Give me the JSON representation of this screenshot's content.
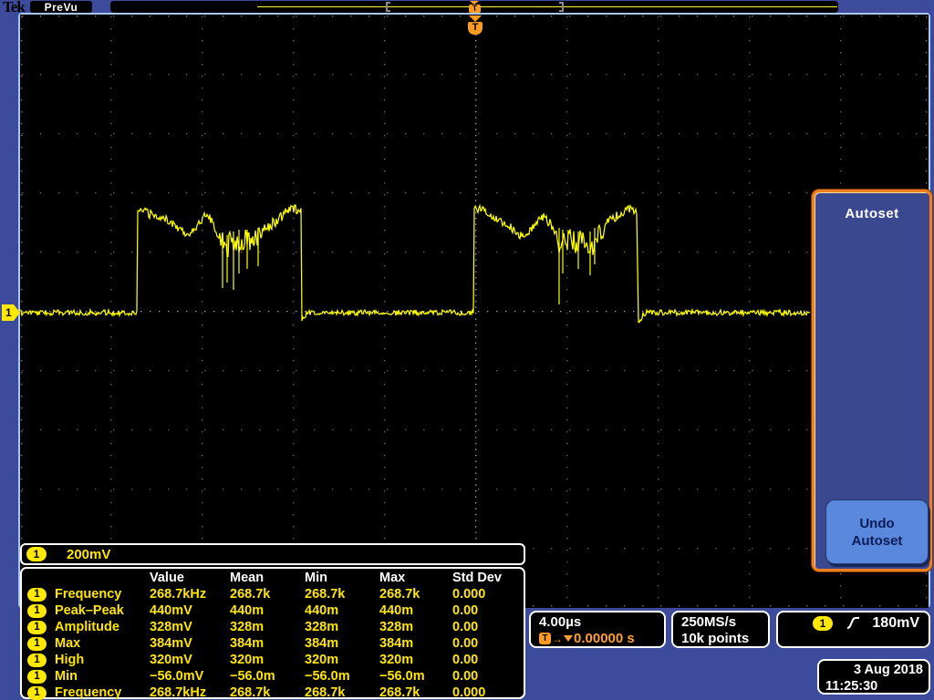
{
  "top_bar": {
    "logo": "Tek",
    "acq_status": "PreVu",
    "trigger_symbol": "T"
  },
  "channel": {
    "id": "1",
    "scale": "200mV"
  },
  "measurements": {
    "columns": [
      "Value",
      "Mean",
      "Min",
      "Max",
      "Std Dev"
    ],
    "rows": [
      {
        "ch": "1",
        "name": "Frequency",
        "value": "268.7kHz",
        "mean": "268.7k",
        "min": "268.7k",
        "max": "268.7k",
        "stddev": "0.000"
      },
      {
        "ch": "1",
        "name": "Peak–Peak",
        "value": "440mV",
        "mean": "440m",
        "min": "440m",
        "max": "440m",
        "stddev": "0.00"
      },
      {
        "ch": "1",
        "name": "Amplitude",
        "value": "328mV",
        "mean": "328m",
        "min": "328m",
        "max": "328m",
        "stddev": "0.00"
      },
      {
        "ch": "1",
        "name": "Max",
        "value": "384mV",
        "mean": "384m",
        "min": "384m",
        "max": "384m",
        "stddev": "0.00"
      },
      {
        "ch": "1",
        "name": "High",
        "value": "320mV",
        "mean": "320m",
        "min": "320m",
        "max": "320m",
        "stddev": "0.00"
      },
      {
        "ch": "1",
        "name": "Min",
        "value": "−56.0mV",
        "mean": "−56.0m",
        "min": "−56.0m",
        "max": "−56.0m",
        "stddev": "0.00"
      },
      {
        "ch": "1",
        "name": "Frequency",
        "value": "268.7kHz",
        "mean": "268.7k",
        "min": "268.7k",
        "max": "268.7k",
        "stddev": "0.000"
      }
    ]
  },
  "status_bar": {
    "horizontal_scale": "4.00µs",
    "trigger_t": "T",
    "arrow": "→",
    "horizontal_position": "0.00000 s",
    "sample_rate": "250MS/s",
    "record_length": "10k points",
    "trigger_channel": "1",
    "trigger_level": "180mV"
  },
  "datetime": {
    "date": "3 Aug 2018",
    "time": "11:25:30"
  },
  "menu_panel": {
    "title": "Autoset",
    "button_line1": "Undo",
    "button_line2": "Autoset"
  },
  "colors": {
    "background_blue": "#3c4b9c",
    "trace_yellow": "#ffff00",
    "grid_dot": "#5f5f5f",
    "grid_center_dot": "#9a9a9a",
    "edge_tick": "#787878",
    "orange": "#ff9c20",
    "panel_border_orange": "#f08020",
    "button_blue": "#5988dc"
  },
  "waveform": {
    "volts_per_div": "200mV",
    "time_per_div": "4.00µs",
    "anchors": [
      [
        22,
        343,
        3
      ],
      [
        150,
        343,
        3
      ],
      [
        151,
        231,
        4
      ],
      [
        158,
        233,
        5
      ],
      [
        168,
        236,
        5
      ],
      [
        178,
        239,
        5
      ],
      [
        188,
        244,
        5
      ],
      [
        198,
        251,
        5
      ],
      [
        206,
        257,
        4
      ],
      [
        214,
        251,
        4
      ],
      [
        222,
        240,
        4
      ],
      [
        227,
        233,
        4
      ],
      [
        233,
        243,
        6
      ],
      [
        239,
        258,
        9
      ],
      [
        245,
        266,
        14
      ],
      [
        251,
        268,
        16
      ],
      [
        257,
        262,
        14
      ],
      [
        263,
        268,
        11
      ],
      [
        269,
        262,
        10
      ],
      [
        275,
        266,
        11
      ],
      [
        281,
        261,
        10
      ],
      [
        287,
        255,
        9
      ],
      [
        293,
        251,
        8
      ],
      [
        299,
        246,
        7
      ],
      [
        306,
        240,
        6
      ],
      [
        313,
        233,
        5
      ],
      [
        319,
        229,
        5
      ],
      [
        326,
        230,
        5
      ],
      [
        330,
        231,
        4
      ],
      [
        331,
        352,
        3
      ],
      [
        334,
        347,
        3
      ],
      [
        337,
        344,
        3
      ],
      [
        340,
        343,
        3
      ],
      [
        519,
        343,
        3
      ],
      [
        520,
        228,
        4
      ],
      [
        528,
        231,
        5
      ],
      [
        538,
        235,
        5
      ],
      [
        548,
        241,
        5
      ],
      [
        558,
        248,
        5
      ],
      [
        568,
        256,
        5
      ],
      [
        575,
        260,
        4
      ],
      [
        583,
        251,
        4
      ],
      [
        591,
        241,
        4
      ],
      [
        597,
        237,
        4
      ],
      [
        603,
        246,
        6
      ],
      [
        609,
        260,
        9
      ],
      [
        614,
        268,
        13
      ],
      [
        620,
        266,
        13
      ],
      [
        626,
        261,
        12
      ],
      [
        632,
        267,
        13
      ],
      [
        638,
        261,
        10
      ],
      [
        643,
        268,
        11
      ],
      [
        648,
        275,
        12
      ],
      [
        653,
        262,
        10
      ],
      [
        659,
        254,
        11
      ],
      [
        665,
        247,
        8
      ],
      [
        671,
        240,
        6
      ],
      [
        677,
        236,
        5
      ],
      [
        684,
        232,
        5
      ],
      [
        691,
        230,
        5
      ],
      [
        698,
        231,
        4
      ],
      [
        700,
        355,
        3
      ],
      [
        703,
        349,
        3
      ],
      [
        706,
        344,
        3
      ],
      [
        710,
        343,
        3
      ],
      [
        888,
        343,
        3
      ]
    ],
    "spikes": [
      [
        244,
        255,
        316
      ],
      [
        249,
        258,
        310
      ],
      [
        256,
        254,
        318
      ],
      [
        262,
        252,
        300
      ],
      [
        271,
        252,
        295
      ],
      [
        283,
        250,
        292
      ],
      [
        613,
        250,
        334
      ],
      [
        617,
        252,
        300
      ],
      [
        634,
        254,
        295
      ],
      [
        647,
        254,
        302
      ],
      [
        652,
        250,
        290
      ]
    ]
  }
}
